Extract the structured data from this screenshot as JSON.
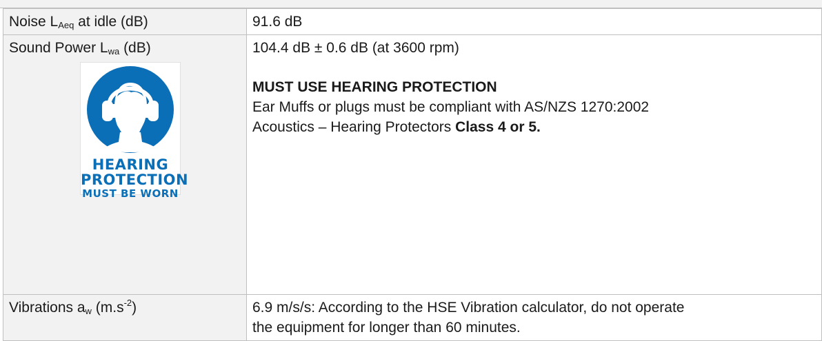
{
  "rows": [
    {
      "label_main": "Noise L",
      "label_sub": "Aeq",
      "label_tail": " at idle (dB)",
      "value": "91.6 dB"
    },
    {
      "label_main": "Sound Power L",
      "label_sub": "wa",
      "label_tail": " (dB)",
      "value_line1": "104.4 dB ± 0.6 dB (at 3600 rpm)",
      "heading": "MUST USE HEARING PROTECTION",
      "body_line1": "Ear Muffs or plugs must be compliant with AS/NZS 1270:2002",
      "body_line2_prefix": "Acoustics – Hearing Protectors ",
      "body_line2_bold": "Class 4 or 5.",
      "sign": {
        "line1": "HEARING",
        "line2": "PROTECTION",
        "line3": "MUST BE WORN",
        "color": "#0b6fb8",
        "icon": "hearing-protection-icon"
      }
    },
    {
      "label_main": "Vibrations a",
      "label_sub": "w",
      "label_tail_pre": " (m.s",
      "label_sup": "-2",
      "label_tail_post": ")",
      "value_line1": "6.9 m/s/s: According to the HSE Vibration calculator, do not operate",
      "value_line2": "the equipment for longer than 60 minutes."
    }
  ]
}
